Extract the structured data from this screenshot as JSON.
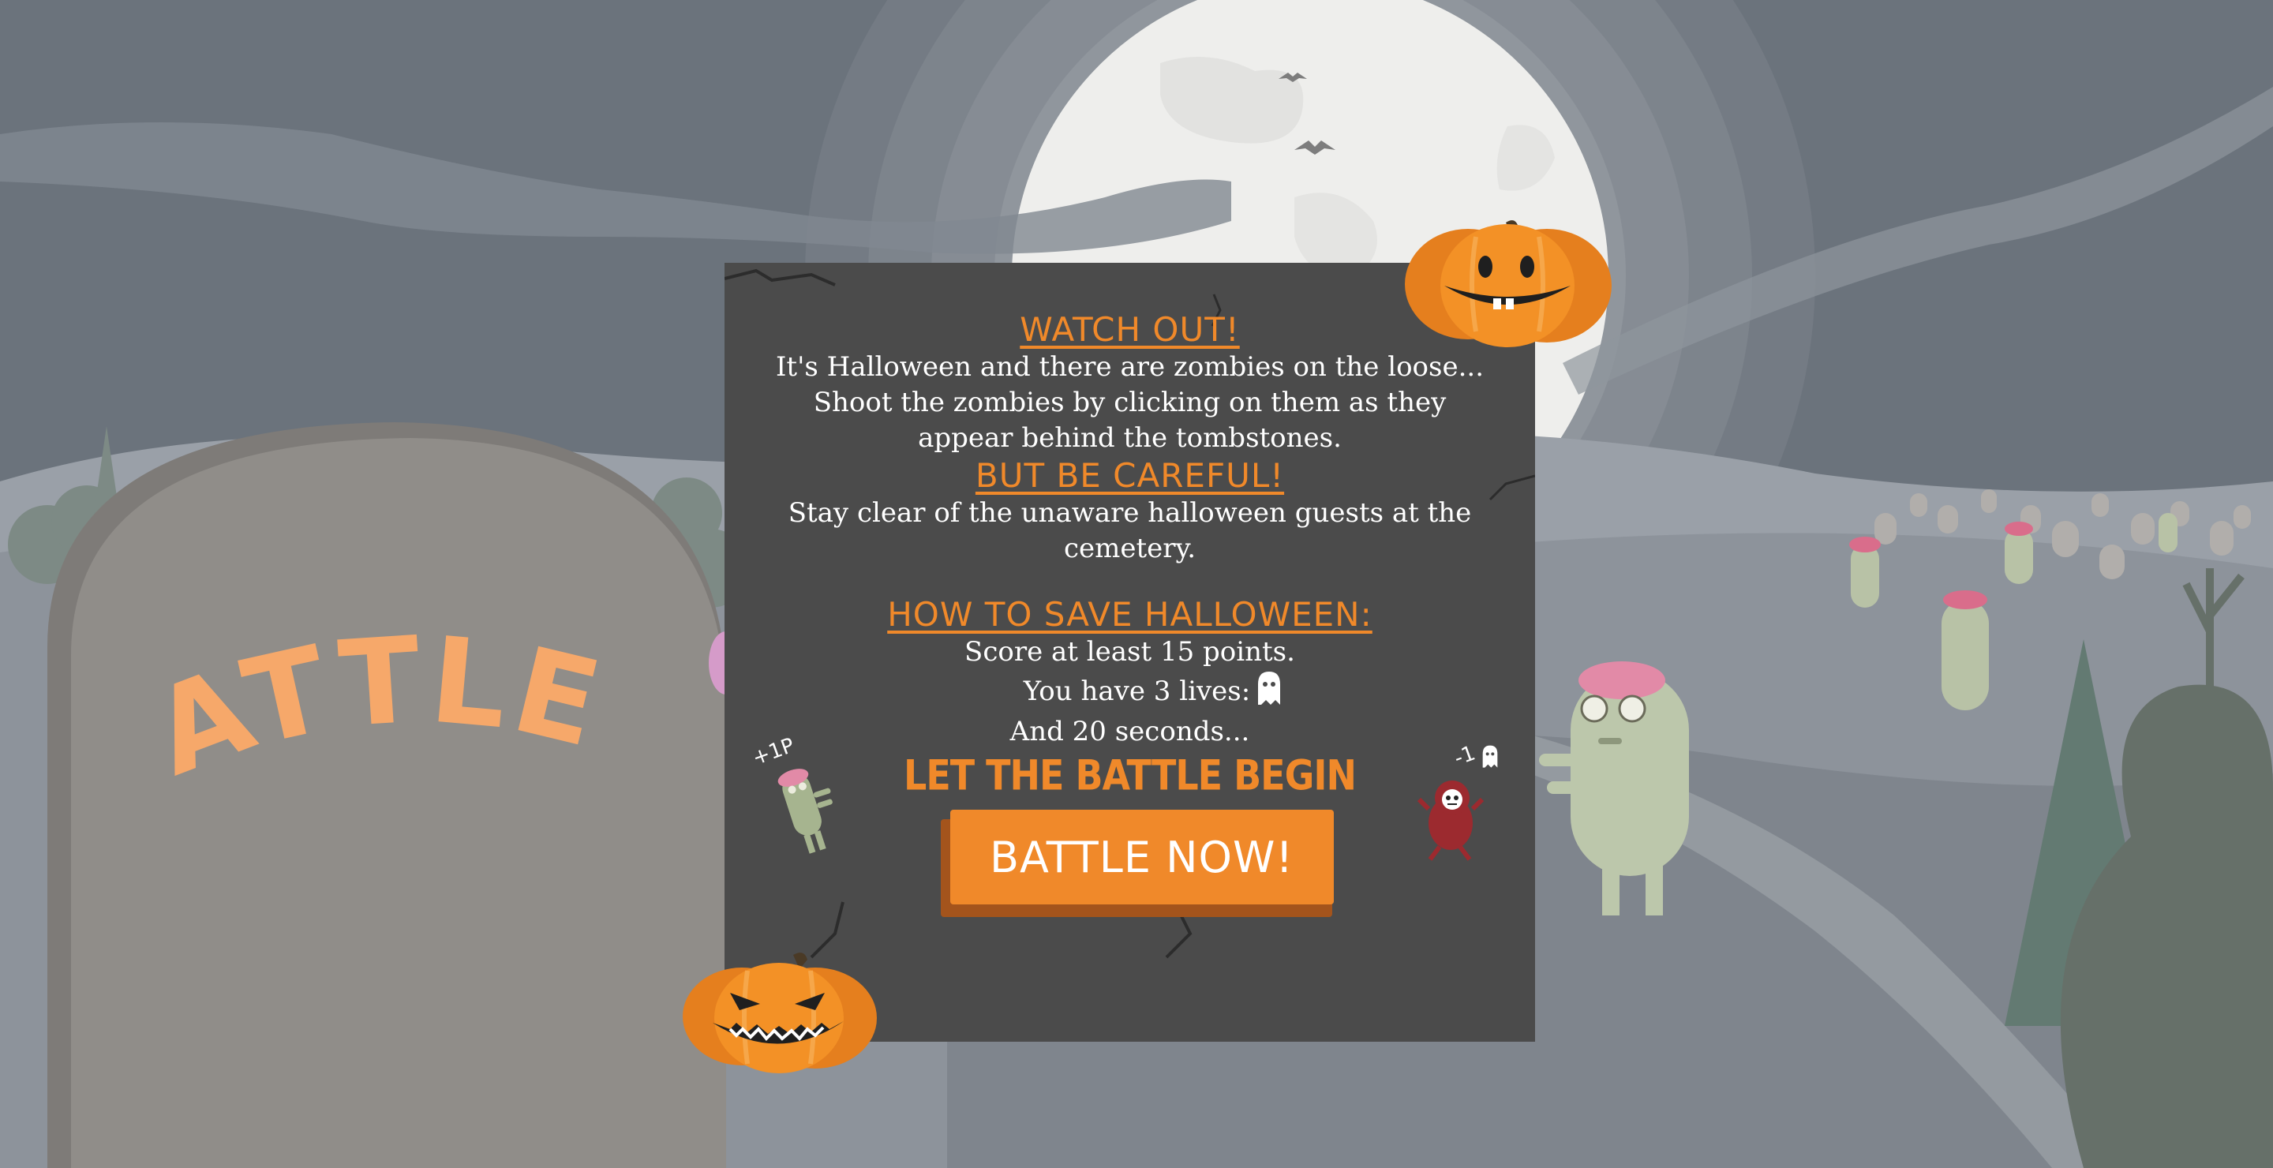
{
  "game": {
    "logo_text": "BATTLE Z"
  },
  "dialog": {
    "heading_watch": "WATCH OUT!",
    "intro_lines": [
      "It's Halloween and there are zombies on the loose...",
      "Shoot the zombies by clicking on them as they",
      "appear behind the tombstones."
    ],
    "heading_careful": "BUT BE CAREFUL!",
    "warning_lines": [
      "Stay clear of the unaware halloween guests at the",
      "cemetery."
    ],
    "heading_how": "HOW TO SAVE HALLOWEEN:",
    "rule_score": "Score at least 15 points.",
    "rule_lives": "You have 3 lives:",
    "rule_time": "And 20 seconds...",
    "tagline": "LET THE BATTLE BEGIN",
    "start_button": "BATTLE NOW!",
    "zombie_points_label": "+1P",
    "guest_penalty_label": "-1"
  },
  "icons": {
    "lives": "ghost-icon",
    "zombie": "zombie-icon",
    "guest": "devil-guest-icon",
    "pumpkin": "jack-o-lantern-icon"
  },
  "colors": {
    "accent": "#f0892a",
    "panel": "#4b4b4b",
    "button_shadow": "#a4541c",
    "tombstone": "#908d89",
    "sky": "#6b737c",
    "moon": "#eeeeec"
  }
}
